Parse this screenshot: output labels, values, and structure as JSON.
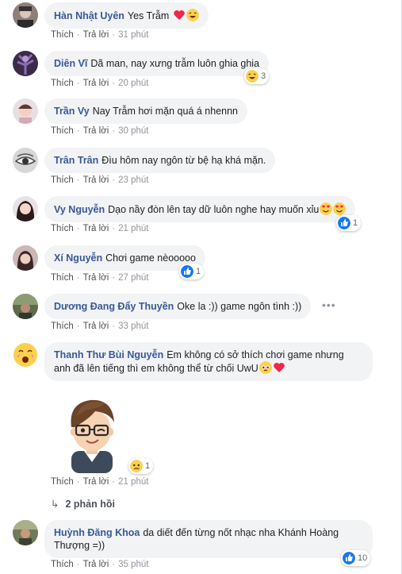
{
  "comments": [
    {
      "name": "Hàn Nhật Uyên",
      "text": "Yes Trẫm",
      "like": "Thích",
      "reply": "Trả lời",
      "time": "31 phút"
    },
    {
      "name": "Diên Vĩ",
      "text": "Dã man, nay xưng trẫm luôn ghia ghia",
      "like": "Thích",
      "reply": "Trả lời",
      "time": "20 phút",
      "reaction_count": "3"
    },
    {
      "name": "Trần Vy",
      "text": "Nay Trẫm hơi mặn quá á nhennn",
      "like": "Thích",
      "reply": "Trả lời",
      "time": "30 phút"
    },
    {
      "name": "Trân Trân",
      "text": "Đìu hôm nay ngôn từ bệ hạ khá mặn.",
      "like": "Thích",
      "reply": "Trả lời",
      "time": "23 phút"
    },
    {
      "name": "Vy Nguyễn",
      "text": "Dạo nầy đòn lên tay dữ luôn nghe hay muốn xỉu",
      "like": "Thích",
      "reply": "Trả lời",
      "time": "21 phút",
      "reaction_count": "1"
    },
    {
      "name": "Xí Nguyễn",
      "text": "Chơi game nèooooo",
      "like": "Thích",
      "reply": "Trả lời",
      "time": "27 phút",
      "reaction_count": "1"
    },
    {
      "name": "Dương Đang Đẩy Thuyền",
      "text": "Oke la :)) game ngôn tình :))",
      "like": "Thích",
      "reply": "Trả lời",
      "time": "33 phút",
      "more": "•••"
    },
    {
      "name": "Thanh Thư Bùi Nguyễn",
      "text_line1": "Em không có sở thích chơi game nhưng",
      "text_line2": "anh đã lên tiếng thì em không thể từ chối UwU",
      "like": "Thích",
      "reply": "Trả lời",
      "time": "21 phút",
      "reaction_count": "1",
      "replies_label": "2 phản hồi"
    },
    {
      "name": "Huỳnh Đăng Khoa",
      "text_line1": "da diết đến từng nốt nhạc nha Khánh Hoàng",
      "text_line2": "Thượng =))",
      "like": "Thích",
      "reply": "Trả lời",
      "time": "35 phút",
      "reaction_count": "10"
    }
  ],
  "colors": {
    "name": "#385898",
    "bubble": "#f2f3f5",
    "meta": "#90949c",
    "like_blue": "#1877f2",
    "heart_red": "#f0284a",
    "emoji_yellow": "#fcd04e"
  },
  "icons": [
    "like-icon",
    "haha-icon",
    "love-eyes-icon",
    "heart-icon",
    "sad-icon",
    "reply-arrow-icon",
    "more-options-icon"
  ]
}
